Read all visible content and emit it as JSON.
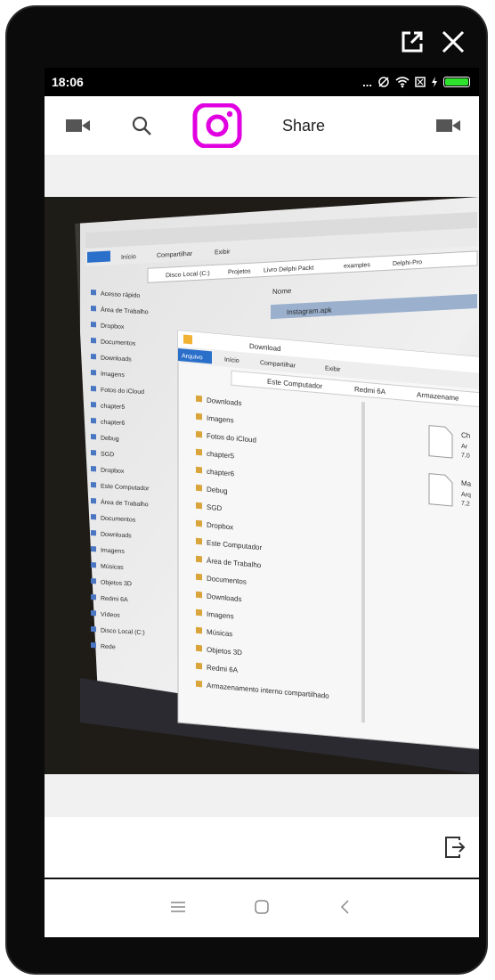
{
  "status_bar": {
    "time": "18:06",
    "dots": "..."
  },
  "toolbar": {
    "share_label": "Share"
  },
  "photo": {
    "back_window": {
      "tabs": [
        "Início",
        "Compartilhar",
        "Exibir"
      ],
      "path": [
        "Disco Local (C:)",
        "Projetos",
        "Livro Delphi Packt",
        "examples",
        "Delphi-Pro"
      ],
      "column_header": "Nome",
      "selected_file": "Instagram.apk",
      "sidebar": [
        "Acesso rápido",
        "Área de Trabalho",
        "Dropbox",
        "Documentos",
        "Downloads",
        "Imagens",
        "Fotos do iCloud",
        "chapter5",
        "chapter6",
        "Debug",
        "SGD",
        "Dropbox",
        "Este Computador",
        "Área de Trabalho",
        "Documentos",
        "Downloads",
        "Imagens",
        "Músicas",
        "Objetos 3D",
        "Redmi 6A",
        "Vídeos",
        "Disco Local (C:)",
        "Rede"
      ]
    },
    "front_window": {
      "title": "Download",
      "tabs": [
        "Arquivo",
        "Início",
        "Compartilhar",
        "Exibir"
      ],
      "path": [
        "Este Computador",
        "Redmi 6A",
        "Armazename"
      ],
      "sidebar": [
        "Downloads",
        "Imagens",
        "Fotos do iCloud",
        "chapter5",
        "chapter6",
        "Debug",
        "SGD",
        "Dropbox",
        "Este Computador",
        "Área de Trabalho",
        "Documentos",
        "Downloads",
        "Imagens",
        "Músicas",
        "Objetos 3D",
        "Redmi 6A",
        "Armazenamento interno compartilhado"
      ],
      "files": [
        {
          "name": "Ch",
          "type": "Ar",
          "size": "7,0"
        },
        {
          "name": "Ma",
          "type": "Arq",
          "size": "7,2"
        }
      ]
    }
  },
  "colors": {
    "instagram_accent": "#e000e0",
    "battery": "#2ee12e"
  }
}
